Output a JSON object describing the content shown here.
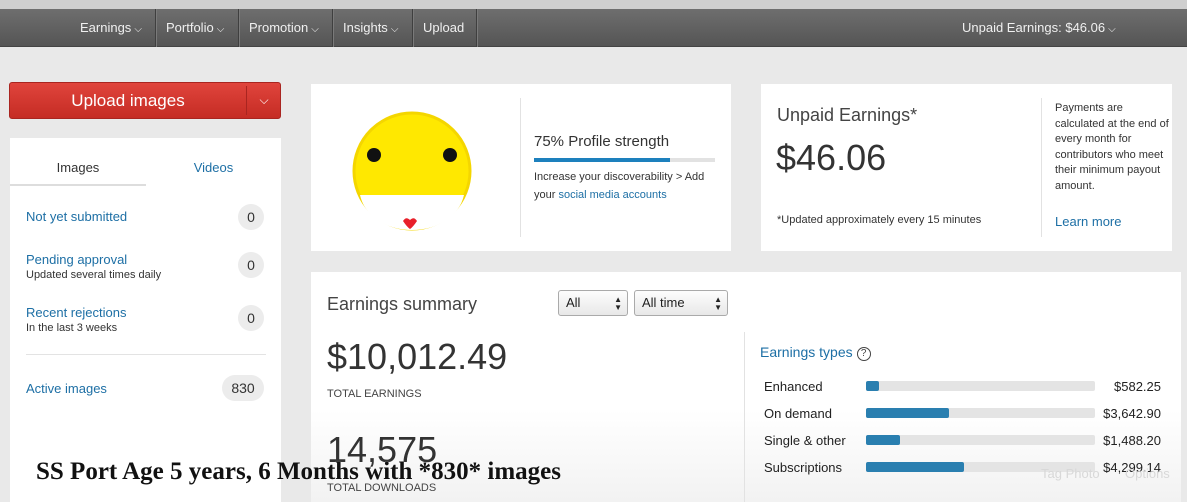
{
  "nav": {
    "items": [
      {
        "label": "Earnings",
        "chevron": true
      },
      {
        "label": "Portfolio",
        "chevron": true
      },
      {
        "label": "Promotion",
        "chevron": true
      },
      {
        "label": "Insights",
        "chevron": true
      },
      {
        "label": "Upload",
        "chevron": false
      }
    ],
    "unpaid": "Unpaid Earnings: $46.06"
  },
  "upload": {
    "label": "Upload images"
  },
  "left": {
    "tabs": {
      "images": "Images",
      "videos": "Videos"
    },
    "rows": [
      {
        "title": "Not yet submitted",
        "sub": "",
        "count": "0"
      },
      {
        "title": "Pending approval",
        "sub": "Updated several times daily",
        "count": "0"
      },
      {
        "title": "Recent rejections",
        "sub": "In the last 3 weeks",
        "count": "0"
      }
    ],
    "active": {
      "title": "Active images",
      "count": "830"
    }
  },
  "profile": {
    "strength_label": "75% Profile strength",
    "strength_value": 0.75,
    "text": "Increase your discoverability > Add your",
    "link": "social media accounts"
  },
  "unpaid_card": {
    "title": "Unpaid Earnings*",
    "amount": "$46.06",
    "note": "*Updated approximately every 15 minutes",
    "payments_text": "Payments are calculated at the end of every month for contributors who meet their minimum payout amount.",
    "learn_more": "Learn more"
  },
  "summary": {
    "title": "Earnings summary",
    "filter1": "All",
    "filter2": "All time",
    "total_amount": "$10,012.49",
    "total_label": "TOTAL EARNINGS",
    "downloads": "14,575",
    "downloads_label": "TOTAL DOWNLOADS",
    "types_title": "Earnings types",
    "types": [
      {
        "name": "Enhanced",
        "value": "$582.25",
        "share": 0.058
      },
      {
        "name": "On demand",
        "value": "$3,642.90",
        "share": 0.364
      },
      {
        "name": "Single & other",
        "value": "$1,488.20",
        "share": 0.149
      },
      {
        "name": "Subscriptions",
        "value": "$4,299.14",
        "share": 0.429
      }
    ]
  },
  "overlay": {
    "caption": "SS Port Age 5 years, 6 Months with *830* images",
    "tag_photo": "Tag Photo",
    "options": "Options"
  }
}
